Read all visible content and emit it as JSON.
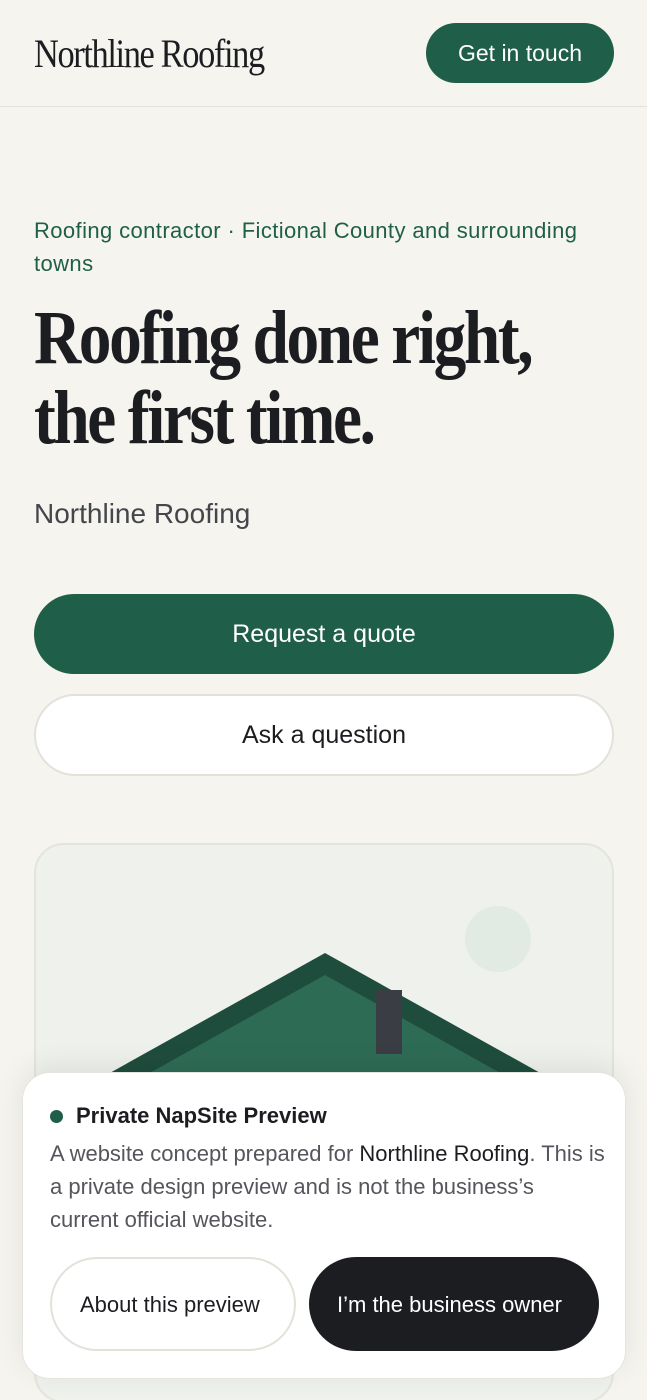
{
  "header": {
    "logo": "Northline Roofing",
    "cta_label": "Get in touch"
  },
  "hero": {
    "eyebrow": "Roofing contractor · Fictional County and surrounding towns",
    "headline_line1": "Roofing done right,",
    "headline_line2": "the first time.",
    "business_name": "Northline Roofing",
    "primary_button": "Request a quote",
    "secondary_button": "Ask a question"
  },
  "illustration": {
    "icon": "house-roof-illustration",
    "roof_color": "#2e6b55",
    "roof_edge_color": "#1f4d3d",
    "chimney_color": "#3a3d44",
    "sun_color": "#e1ebe4"
  },
  "banner": {
    "title": "Private NapSite Preview",
    "text_before": "A website concept prepared for ",
    "text_bold": "Northline Roofing",
    "text_after": ". This is a private design preview and is not the business’s current official website.",
    "about_button": "About this preview",
    "owner_button": "I’m the business owner"
  },
  "colors": {
    "brand_green": "#1f5f49",
    "background": "#f5f4ef",
    "dark": "#1c1d21"
  }
}
